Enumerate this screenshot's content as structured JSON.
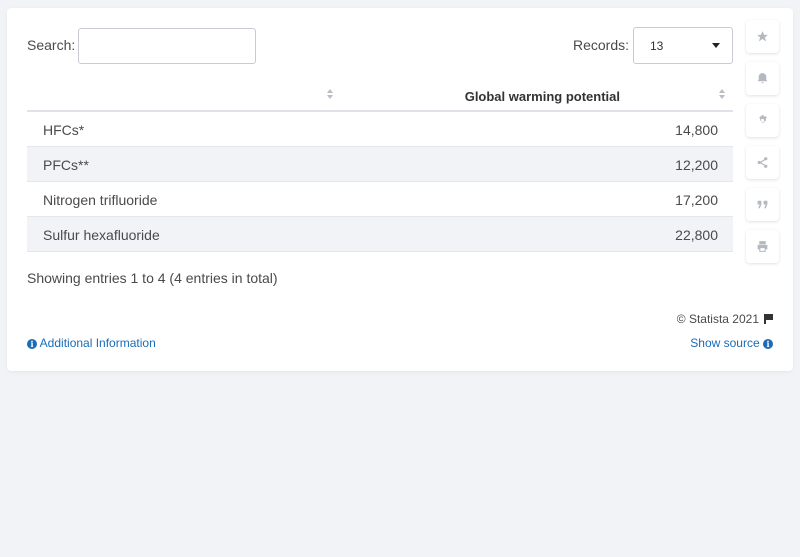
{
  "search": {
    "label": "Search:",
    "value": "",
    "placeholder": ""
  },
  "records": {
    "label": "Records:",
    "selected": "13"
  },
  "table": {
    "columns": [
      "",
      "Global warming potential"
    ],
    "rows": [
      {
        "name": "HFCs*",
        "value": "14,800"
      },
      {
        "name": "PFCs**",
        "value": "12,200"
      },
      {
        "name": "Nitrogen trifluoride",
        "value": "17,200"
      },
      {
        "name": "Sulfur hexafluoride",
        "value": "22,800"
      }
    ]
  },
  "footer": {
    "showing": "Showing entries 1 to 4 (4 entries in total)",
    "copyright": "© Statista 2021",
    "additional_info": "Additional Information",
    "show_source": "Show source"
  },
  "sidebar": {
    "icons": [
      "star-icon",
      "bell-icon",
      "gear-icon",
      "share-icon",
      "quote-icon",
      "print-icon"
    ]
  },
  "colors": {
    "link": "#1a6cb6",
    "row_alt": "#f1f3f6",
    "background": "#f1f3f6"
  }
}
